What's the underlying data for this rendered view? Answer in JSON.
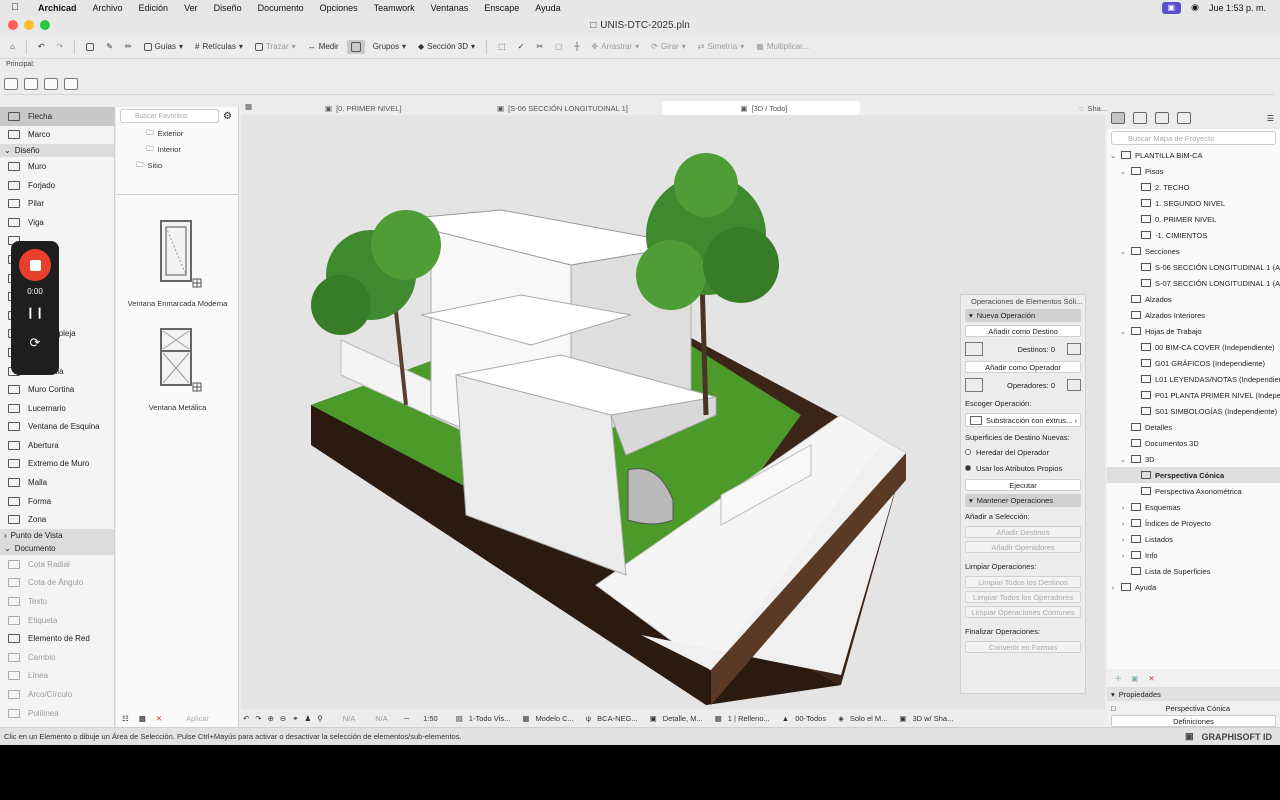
{
  "menubar": {
    "items": [
      "Archicad",
      "Archivo",
      "Edición",
      "Ver",
      "Diseño",
      "Documento",
      "Opciones",
      "Teamwork",
      "Ventanas",
      "Enscape",
      "Ayuda"
    ],
    "clock": "Jue 1:53 p. m."
  },
  "window": {
    "title": "UNIS-DTC-2025.pln"
  },
  "toolbar": {
    "guias": "Guías",
    "reticulas": "Retículas",
    "trazar": "Trazar",
    "medir": "Medir",
    "grupos": "Grupos",
    "seccion3d": "Sección 3D",
    "arrastrar": "Arrastrar",
    "girar": "Girar",
    "simetria": "Simetría",
    "multiplicar": "Multiplicar..."
  },
  "principal": "Principal:",
  "toolbox": {
    "items": [
      {
        "label": "Flecha",
        "kind": "item",
        "selected": true
      },
      {
        "label": "Marco",
        "kind": "item"
      },
      {
        "label": "Diseño",
        "kind": "head"
      },
      {
        "label": "Muro",
        "kind": "item"
      },
      {
        "label": "Forjado",
        "kind": "item"
      },
      {
        "label": "Pilar",
        "kind": "item"
      },
      {
        "label": "Viga",
        "kind": "item"
      },
      {
        "label": "",
        "kind": "item"
      },
      {
        "label": "",
        "kind": "item"
      },
      {
        "label": "",
        "kind": "item"
      },
      {
        "label": "",
        "kind": "item"
      },
      {
        "label": "",
        "kind": "item"
      },
      {
        "label": "ura Compleja",
        "kind": "item"
      },
      {
        "label": "",
        "kind": "item"
      },
      {
        "label": "Barandilla",
        "kind": "item"
      },
      {
        "label": "Muro Cortina",
        "kind": "item"
      },
      {
        "label": "Lucernario",
        "kind": "item"
      },
      {
        "label": "Ventana de Esquina",
        "kind": "item"
      },
      {
        "label": "Abertura",
        "kind": "item"
      },
      {
        "label": "Extremo de Muro",
        "kind": "item"
      },
      {
        "label": "Malla",
        "kind": "item"
      },
      {
        "label": "Forma",
        "kind": "item"
      },
      {
        "label": "Zona",
        "kind": "item"
      },
      {
        "label": "Punto de Vista",
        "kind": "head"
      },
      {
        "label": "Documento",
        "kind": "head"
      },
      {
        "label": "Cota Radial",
        "kind": "item",
        "disabled": true
      },
      {
        "label": "Cota de Ángulo",
        "kind": "item",
        "disabled": true
      },
      {
        "label": "Texto",
        "kind": "item",
        "disabled": true
      },
      {
        "label": "Etiqueta",
        "kind": "item",
        "disabled": true
      },
      {
        "label": "Elemento de Red",
        "kind": "item"
      },
      {
        "label": "Cambio",
        "kind": "item",
        "disabled": true
      },
      {
        "label": "Línea",
        "kind": "item",
        "disabled": true
      },
      {
        "label": "Arco/Círculo",
        "kind": "item",
        "disabled": true
      },
      {
        "label": "Polilínea",
        "kind": "item",
        "disabled": true
      }
    ]
  },
  "recorder": {
    "time": "0:00"
  },
  "favorites": {
    "search_placeholder": "Buscar Favoritos",
    "tree": [
      "Exterior",
      "Interior",
      "Sitio"
    ],
    "objects": [
      "Ventana Enmarcada Moderna",
      "Ventana Metálica"
    ],
    "apply": "Aplicar"
  },
  "tabs": [
    {
      "label": "[0. PRIMER NIVEL]",
      "active": false
    },
    {
      "label": "[S-06 SECCIÓN LONGITUDINAL 1]",
      "active": false
    },
    {
      "label": "[3D / Todo]",
      "active": true
    }
  ],
  "tabs_extra": "Sha...",
  "palette": {
    "title": "Operaciones de Elementos Sóli...",
    "nueva": "Nueva Operación",
    "add_target": "Añadir como Destino",
    "destinos": "Destinos: 0",
    "add_operator": "Añadir como Operador",
    "operadores": "Operadores: 0",
    "escoger": "Escoger Operación:",
    "operation": "Substracción con extrus...",
    "superficies": "Superficies de Destino Nuevas:",
    "heredar": "Heredar del Operador",
    "usar": "Usar los Atributos Propios",
    "ejecutar": "Ejecutar",
    "mantener": "Mantener Operaciones",
    "anadir_sel": "Añadir a Selección:",
    "anadir_destinos": "Añadir Destinos",
    "anadir_operadores": "Añadir Operadores",
    "limpiar": "Limpiar Operaciones:",
    "limpiar_destinos": "Limpiar Todos los Destinos",
    "limpiar_operadores": "Limpiar Todos los Operadores",
    "limpiar_comunes": "Limpiar Operaciones Comunes",
    "finalizar": "Finalizar Operaciones:",
    "convertir": "Convertir en Formas"
  },
  "navigator": {
    "search_placeholder": "Buscar Mapa de Proyecto",
    "items": [
      {
        "label": "PLANTILLA BIM-CA",
        "level": 0,
        "arrow": "v"
      },
      {
        "label": "Pisos",
        "level": 1,
        "arrow": "v"
      },
      {
        "label": "2. TECHO",
        "level": 2,
        "arrow": ""
      },
      {
        "label": "1. SEGUNDO NIVEL",
        "level": 2,
        "arrow": ""
      },
      {
        "label": "0. PRIMER NIVEL",
        "level": 2,
        "arrow": ""
      },
      {
        "label": "-1. CIMIENTOS",
        "level": 2,
        "arrow": ""
      },
      {
        "label": "Secciones",
        "level": 1,
        "arrow": "v"
      },
      {
        "label": "S-06 SECCIÓN LONGITUDINAL 1 (Au",
        "level": 2,
        "arrow": ""
      },
      {
        "label": "S-07 SECCIÓN LONGITUDINAL 1 (Au",
        "level": 2,
        "arrow": ""
      },
      {
        "label": "Alzados",
        "level": 1,
        "arrow": ""
      },
      {
        "label": "Alzados Interiores",
        "level": 1,
        "arrow": ""
      },
      {
        "label": "Hojas de Trabajo",
        "level": 1,
        "arrow": "v"
      },
      {
        "label": "00 BIM-CA COVER (Independiente)",
        "level": 2,
        "arrow": ""
      },
      {
        "label": "G01 GRÁFICOS (Independiente)",
        "level": 2,
        "arrow": ""
      },
      {
        "label": "L01 LEYENDAS/NOTAS (Independien",
        "level": 2,
        "arrow": ""
      },
      {
        "label": "P01 PLANTA PRIMER NIVEL (Indepen",
        "level": 2,
        "arrow": ""
      },
      {
        "label": "S01 SIMBOLOGÍAS (Independiente)",
        "level": 2,
        "arrow": ""
      },
      {
        "label": "Detalles",
        "level": 1,
        "arrow": ""
      },
      {
        "label": "Documentos 3D",
        "level": 1,
        "arrow": ""
      },
      {
        "label": "3D",
        "level": 1,
        "arrow": "v"
      },
      {
        "label": "Perspectiva Cónica",
        "level": 2,
        "arrow": "",
        "selected": true
      },
      {
        "label": "Perspectiva Axonométrica",
        "level": 2,
        "arrow": ""
      },
      {
        "label": "Esquemas",
        "level": 1,
        "arrow": ">"
      },
      {
        "label": "Índices de Proyecto",
        "level": 1,
        "arrow": ">"
      },
      {
        "label": "Listados",
        "level": 1,
        "arrow": ">"
      },
      {
        "label": "Info",
        "level": 1,
        "arrow": ">"
      },
      {
        "label": "Lista de Superficies",
        "level": 1,
        "arrow": ""
      },
      {
        "label": "Ayuda",
        "level": 0,
        "arrow": ">"
      }
    ],
    "propiedades": "Propiedades",
    "selected_view": "Perspectiva Cónica",
    "definiciones": "Definiciones"
  },
  "viewbar": {
    "items": [
      "N/A",
      "N/A",
      "1:50",
      "1-Todo Vis...",
      "Modelo C...",
      "BCA-NEG...",
      "Detalle, M...",
      "1 | Relleno...",
      "00-Todos",
      "Solo el M...",
      "3D w/ Sha..."
    ]
  },
  "status": {
    "message": "Clic en un Elemento o dibuje un Área de Selección. Pulse Ctrl+Mayús para activar o desactivar la selección de elementos/sub-elementos.",
    "brand": "GRAPHISOFT ID"
  }
}
